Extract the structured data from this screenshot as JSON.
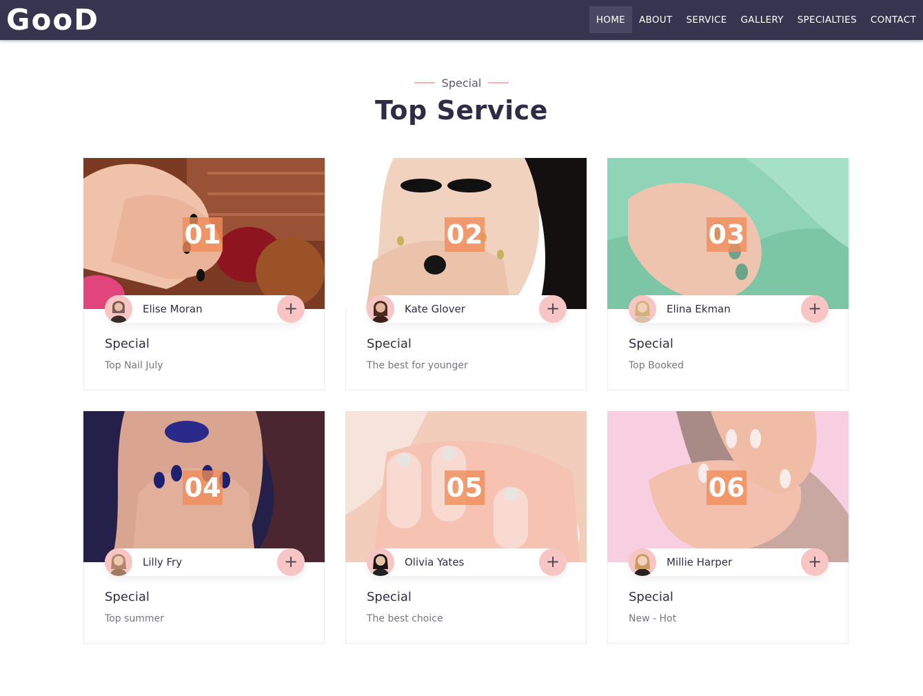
{
  "brand": {
    "logo": "GooD"
  },
  "nav": {
    "items": [
      {
        "label": "HOME",
        "active": true
      },
      {
        "label": "ABOUT"
      },
      {
        "label": "SERVICE"
      },
      {
        "label": "GALLERY"
      },
      {
        "label": "SPECIALTIES"
      },
      {
        "label": "CONTACT"
      }
    ]
  },
  "section": {
    "kicker": "Special",
    "title": "Top Service"
  },
  "cards": [
    {
      "number": "01",
      "author": "Elise Moran",
      "title": "Special",
      "subtitle": "Top Nail July"
    },
    {
      "number": "02",
      "author": "Kate Glover",
      "title": "Special",
      "subtitle": "The best for younger"
    },
    {
      "number": "03",
      "author": "Elina Ekman",
      "title": "Special",
      "subtitle": "Top Booked"
    },
    {
      "number": "04",
      "author": "Lilly Fry",
      "title": "Special",
      "subtitle": "Top summer"
    },
    {
      "number": "05",
      "author": "Olivia Yates",
      "title": "Special",
      "subtitle": "The best choice"
    },
    {
      "number": "06",
      "author": "Millie Harper",
      "title": "Special",
      "subtitle": "New - Hot"
    }
  ],
  "colors": {
    "navbar": "#37344f",
    "accent_pink": "#f6c5c4",
    "number_badge": "#f08c5a",
    "heading": "#2f2d45"
  },
  "icons": {
    "plus": "plus-icon"
  }
}
